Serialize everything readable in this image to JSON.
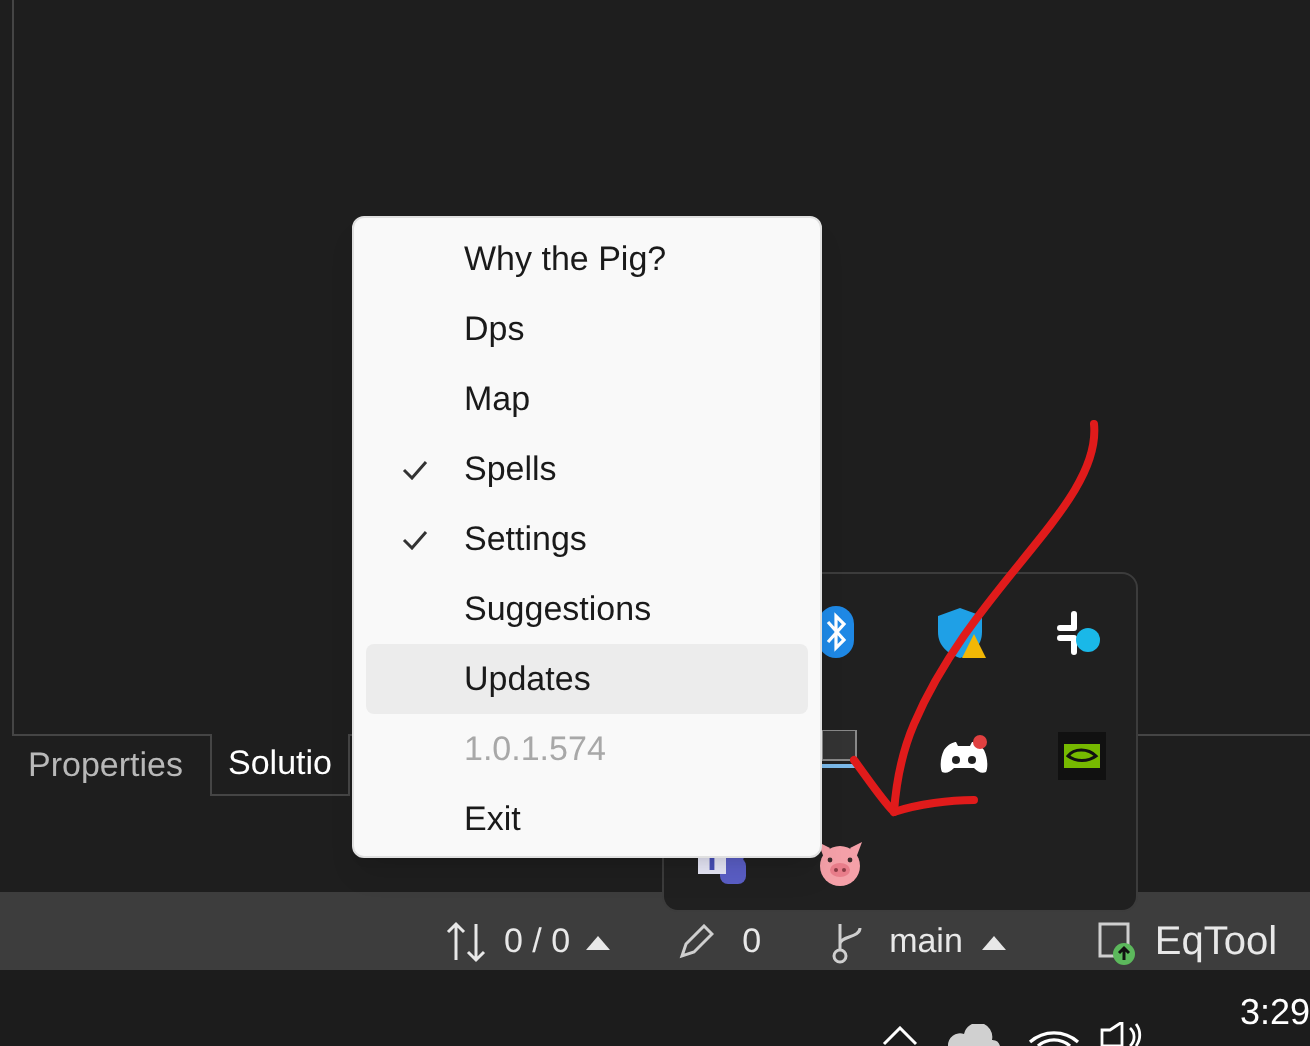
{
  "panel_tabs": [
    {
      "label": "Properties",
      "selected": false
    },
    {
      "label": "Solutio",
      "selected": true
    }
  ],
  "context_menu": {
    "items": [
      {
        "label": "Why the Pig?",
        "checked": false,
        "selected": false,
        "disabled": false
      },
      {
        "label": "Dps",
        "checked": false,
        "selected": false,
        "disabled": false
      },
      {
        "label": "Map",
        "checked": false,
        "selected": false,
        "disabled": false
      },
      {
        "label": "Spells",
        "checked": true,
        "selected": false,
        "disabled": false
      },
      {
        "label": "Settings",
        "checked": true,
        "selected": false,
        "disabled": false
      },
      {
        "label": "Suggestions",
        "checked": false,
        "selected": false,
        "disabled": false
      },
      {
        "label": "Updates",
        "checked": false,
        "selected": true,
        "disabled": false
      },
      {
        "label": "1.0.1.574",
        "checked": false,
        "selected": false,
        "disabled": true
      },
      {
        "label": "Exit",
        "checked": false,
        "selected": false,
        "disabled": false
      }
    ]
  },
  "status_bar": {
    "sync": "0 / 0",
    "edits": "0",
    "branch": "main",
    "repository": "EqTool"
  },
  "taskbar": {
    "time": "3:29"
  }
}
